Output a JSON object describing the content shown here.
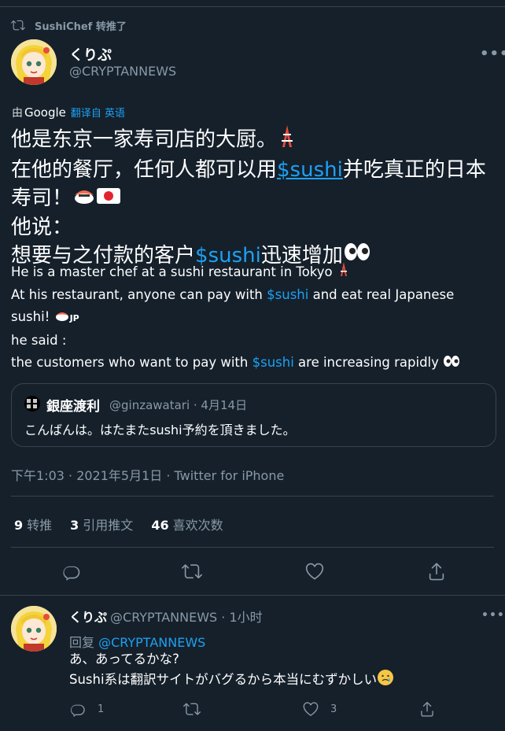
{
  "retweet_header": {
    "text": "SushiChef 转推了"
  },
  "tweet": {
    "display_name": "くりぷ",
    "handle": "@CRYPTANNEWS",
    "translated_by": "由",
    "translated_service": "Google",
    "translated_from": "翻译自 英语",
    "zh_lines": {
      "l1": "他是东京一家寿司店的大厨。",
      "l2a": "在他的餐厅，任何人都可以用",
      "l2_cash": "$sushi",
      "l2b": "并吃真正的日本寿司！",
      "l3": "他说：",
      "l4a": "想要与之付款的客户",
      "l4_cash": "$sushi",
      "l4b": "迅速增加"
    },
    "en_lines": {
      "l1": "He is a master chef at a sushi restaurant in Tokyo",
      "l2a": "At his restaurant, anyone can pay with ",
      "l2_cash": "$sushi",
      "l2b": " and eat real Japanese sushi!",
      "l2_flag": "JP",
      "l3": "he said :",
      "l4a": "the customers who want to pay with ",
      "l4_cash": "$sushi",
      "l4b": " are increasing rapidly"
    },
    "quote": {
      "name": "銀座渡利",
      "meta": "@ginzawatari · 4月14日",
      "text": "こんばんは。はたまたsushi予約を頂きました。"
    },
    "timestamp": "下午1:03 · 2021年5月1日 · Twitter for iPhone",
    "stats": {
      "retweets_num": "9",
      "retweets_label": "转推",
      "quotes_num": "3",
      "quotes_label": "引用推文",
      "likes_num": "46",
      "likes_label": "喜欢次数"
    }
  },
  "reply": {
    "display_name": "くりぷ",
    "meta": "@CRYPTANNEWS · 1小时",
    "replying_prefix": "回复",
    "replying_handle": "@CRYPTANNEWS",
    "line1": "あ、あってるかな?",
    "line2": "Sushi系は翻訳サイトがバグるから本当にむずかしい",
    "reply_count": "1",
    "like_count": "3"
  },
  "icons": {
    "retweet": "retweet-icon",
    "reply": "reply-icon",
    "like": "heart-icon",
    "share": "share-icon",
    "more": "more-icon"
  },
  "colors": {
    "background": "#15202b",
    "link": "#1da1f2",
    "muted": "#8899a6",
    "border": "#38444d"
  }
}
